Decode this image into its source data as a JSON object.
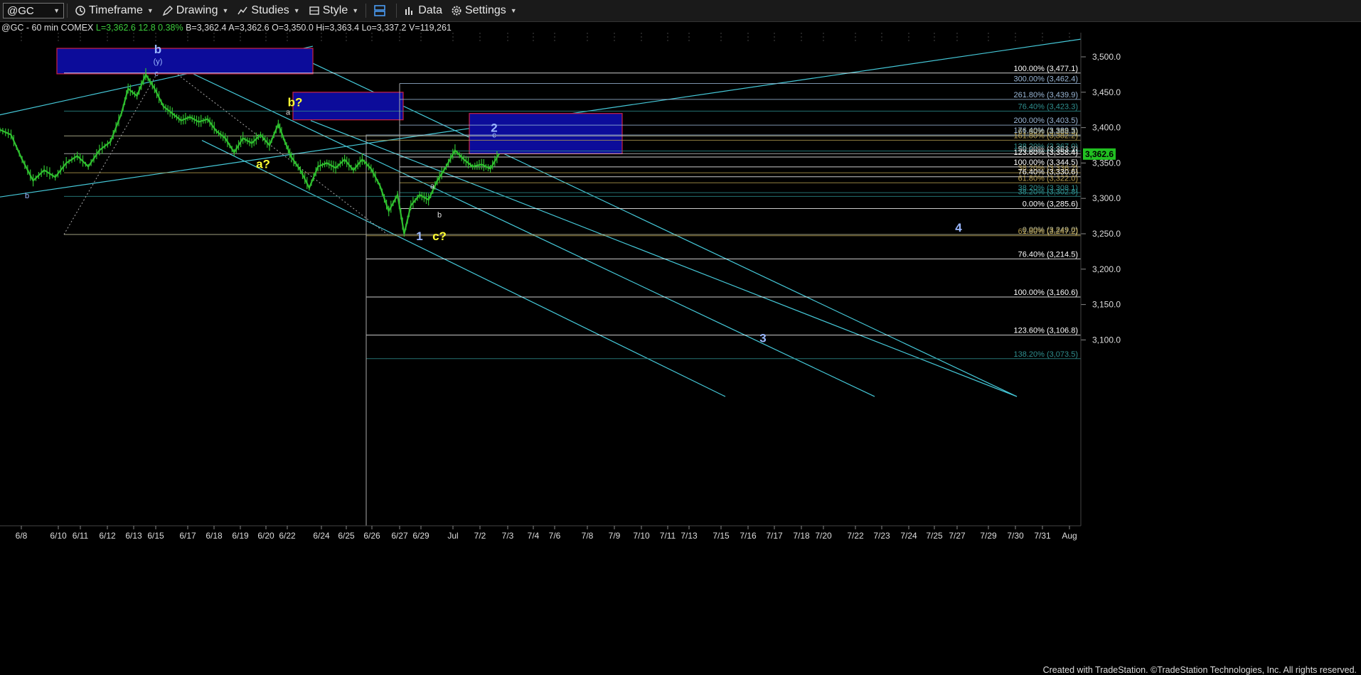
{
  "toolbar": {
    "symbol": "@GC",
    "timeframe": "Timeframe",
    "drawing": "Drawing",
    "studies": "Studies",
    "style": "Style",
    "data": "Data",
    "settings": "Settings"
  },
  "infobar": {
    "symbol_desc": "@GC - 60 min  COMEX",
    "last": "L=3,362.6",
    "change": "12.8",
    "change_pct": "0.38%",
    "bid": "B=3,362.4",
    "ask": "A=3,362.6",
    "open": "O=3,350.0",
    "high": "Hi=3,363.4",
    "low": "Lo=3,337.2",
    "volume": "V=119,261"
  },
  "chart_data": {
    "type": "line",
    "instrument": "@GC",
    "interval": "60 min",
    "last_price": "3,362.6",
    "ylim": [
      3045,
      3525
    ],
    "y_ticks": [
      "3,500.0",
      "3,450.0",
      "3,400.0",
      "3,350.0",
      "3,300.0",
      "3,250.0",
      "3,200.0",
      "3,150.0",
      "3,100.0"
    ],
    "x_ticks": [
      "6/8",
      "6/10",
      "6/11",
      "6/12",
      "6/13",
      "6/15",
      "6/17",
      "6/18",
      "6/19",
      "6/20",
      "6/22",
      "6/24",
      "6/25",
      "6/26",
      "6/27",
      "6/29",
      "Jul",
      "7/2",
      "7/3",
      "7/4",
      "7/6",
      "7/8",
      "7/9",
      "7/10",
      "7/11",
      "7/13",
      "7/15",
      "7/16",
      "7/17",
      "7/18",
      "7/20",
      "7/22",
      "7/23",
      "7/24",
      "7/25",
      "7/27",
      "7/29",
      "7/30",
      "7/31",
      "Aug"
    ],
    "price_path": [
      [
        0,
        3397
      ],
      [
        5,
        3390
      ],
      [
        10,
        3355
      ],
      [
        15,
        3325
      ],
      [
        20,
        3340
      ],
      [
        25,
        3330
      ],
      [
        30,
        3350
      ],
      [
        35,
        3360
      ],
      [
        40,
        3345
      ],
      [
        45,
        3368
      ],
      [
        50,
        3380
      ],
      [
        55,
        3420
      ],
      [
        58,
        3455
      ],
      [
        62,
        3445
      ],
      [
        66,
        3475
      ],
      [
        70,
        3455
      ],
      [
        74,
        3430
      ],
      [
        78,
        3420
      ],
      [
        82,
        3410
      ],
      [
        86,
        3415
      ],
      [
        90,
        3408
      ],
      [
        94,
        3412
      ],
      [
        98,
        3395
      ],
      [
        102,
        3385
      ],
      [
        106,
        3365
      ],
      [
        110,
        3385
      ],
      [
        114,
        3378
      ],
      [
        118,
        3390
      ],
      [
        122,
        3375
      ],
      [
        126,
        3405
      ],
      [
        129,
        3380
      ],
      [
        132,
        3358
      ],
      [
        136,
        3340
      ],
      [
        140,
        3315
      ],
      [
        144,
        3345
      ],
      [
        148,
        3350
      ],
      [
        152,
        3343
      ],
      [
        156,
        3355
      ],
      [
        160,
        3340
      ],
      [
        164,
        3355
      ],
      [
        168,
        3342
      ],
      [
        172,
        3318
      ],
      [
        176,
        3282
      ],
      [
        180,
        3305
      ],
      [
        183,
        3250
      ],
      [
        186,
        3290
      ],
      [
        190,
        3305
      ],
      [
        194,
        3298
      ],
      [
        198,
        3325
      ],
      [
        202,
        3345
      ],
      [
        206,
        3368
      ],
      [
        210,
        3355
      ],
      [
        214,
        3345
      ],
      [
        218,
        3348
      ],
      [
        222,
        3342
      ],
      [
        226,
        3363
      ]
    ],
    "fib_levels": [
      {
        "label": "100.00% (3,477.1)",
        "value": 3477.1,
        "color": "#ffffff"
      },
      {
        "label": "300.00% (3,462.4)",
        "value": 3462.4,
        "color": "#9bb8d8"
      },
      {
        "label": "261.80% (3,439.9)",
        "value": 3439.9,
        "color": "#9bb8d8"
      },
      {
        "label": "76.40% (3,423.3)",
        "value": 3423.3,
        "color": "#2f8f8f"
      },
      {
        "label": "200.00% (3,403.5)",
        "value": 3403.5,
        "color": "#9bb8d8"
      },
      {
        "label": "176.40% (3,389.5)",
        "value": 3389.5,
        "color": "#9bb8d8"
      },
      {
        "label": "61.80% (3,388.3)",
        "value": 3388.3,
        "color": "#c8c8a0"
      },
      {
        "label": "161.80% (3,382.2)",
        "value": 3382.2,
        "color": "#b8a050"
      },
      {
        "label": "138.20% (3,367.0)",
        "value": 3367.0,
        "color": "#2f8f8f"
      },
      {
        "label": "50.00% (3,363.2)",
        "value": 3363.2,
        "color": "#c8c8c8"
      },
      {
        "label": "123.60% (3,358.4)",
        "value": 3358.4,
        "color": "#ffffff"
      },
      {
        "label": "100.00% (3,344.5)",
        "value": 3344.5,
        "color": "#ffffff"
      },
      {
        "label": "38.20% (3,336.2)",
        "value": 3336.2,
        "color": "#b8a050"
      },
      {
        "label": "76.40% (3,330.6)",
        "value": 3330.6,
        "color": "#ffffff"
      },
      {
        "label": "61.80% (3,322.0)",
        "value": 3322.0,
        "color": "#b8a050"
      },
      {
        "label": "38.20% (3,308.1)",
        "value": 3308.1,
        "color": "#2f8f8f"
      },
      {
        "label": "38.20% (3,302.8)",
        "value": 3302.8,
        "color": "#2f8f8f"
      },
      {
        "label": "0.00% (3,285.6)",
        "value": 3285.6,
        "color": "#ffffff"
      },
      {
        "label": "0.00% (3,249.0)",
        "value": 3249.0,
        "color": "#c8c8a0"
      },
      {
        "label": "61.80% (3,247.2)",
        "value": 3247.2,
        "color": "#b8a050"
      },
      {
        "label": "76.40% (3,214.5)",
        "value": 3214.5,
        "color": "#ffffff"
      },
      {
        "label": "100.00% (3,160.6)",
        "value": 3160.6,
        "color": "#ffffff"
      },
      {
        "label": "123.60% (3,106.8)",
        "value": 3106.8,
        "color": "#ffffff"
      },
      {
        "label": "138.20% (3,073.5)",
        "value": 3073.5,
        "color": "#2f8f8f"
      }
    ],
    "wave_labels": [
      {
        "text": "b",
        "color": "#9bb8ff",
        "big": true
      },
      {
        "text": "(y)",
        "color": "#9bb8ff",
        "big": false
      },
      {
        "text": "c",
        "color": "#9bb8ff",
        "big": false
      },
      {
        "text": "b?",
        "color": "#ffff33",
        "big": true
      },
      {
        "text": "a",
        "color": "#dddddd",
        "big": false
      },
      {
        "text": "a?",
        "color": "#ffff33",
        "big": true
      },
      {
        "text": "b",
        "color": "#9bb8ff",
        "big": false
      },
      {
        "text": "2",
        "color": "#9bb8ff",
        "big": true
      },
      {
        "text": "c",
        "color": "#9bb8ff",
        "big": false
      },
      {
        "text": "a",
        "color": "#dddddd",
        "big": false
      },
      {
        "text": "b",
        "color": "#dddddd",
        "big": false
      },
      {
        "text": "1",
        "color": "#9bb8ff",
        "big": true
      },
      {
        "text": "c?",
        "color": "#ffff33",
        "big": true
      },
      {
        "text": "4",
        "color": "#9bb8ff",
        "big": true
      },
      {
        "text": "3",
        "color": "#9bb8ff",
        "big": true
      }
    ],
    "colors": {
      "price": "#2fbf2f",
      "channel": "#45c8d8",
      "box_fill": "#0c0c9a",
      "box_border": "#cc2244",
      "last_badge": "#21c021"
    }
  },
  "footer": "Created with TradeStation. ©TradeStation Technologies, Inc. All rights reserved."
}
